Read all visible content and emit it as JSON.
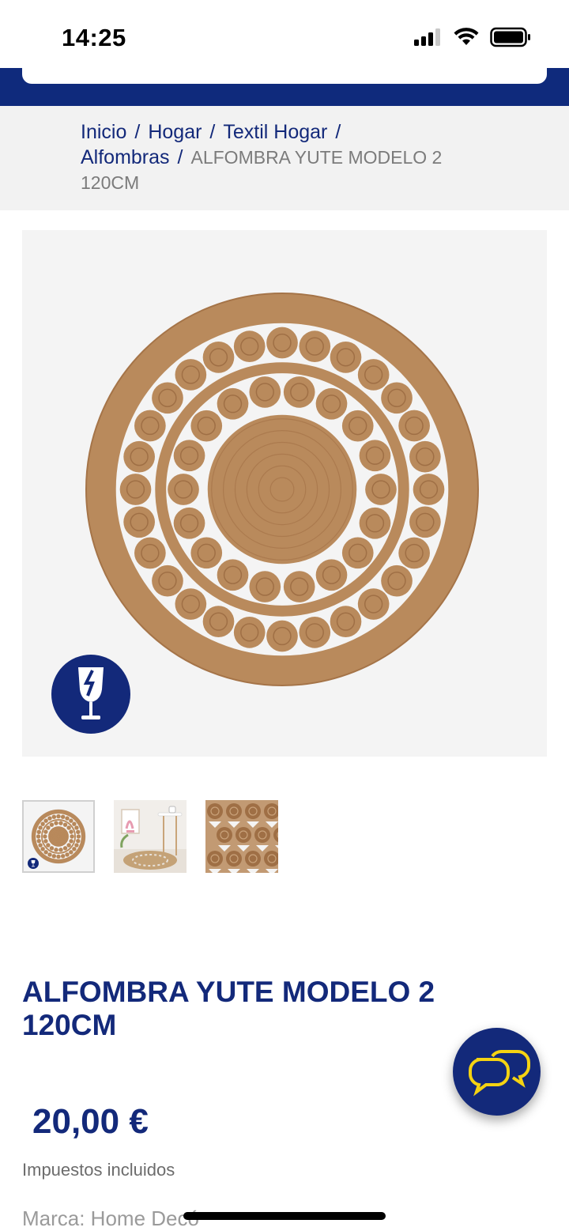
{
  "status_bar": {
    "time": "14:25"
  },
  "breadcrumb": {
    "items": [
      "Inicio",
      "Hogar",
      "Textil Hogar",
      "Alfombras"
    ],
    "separator": "/",
    "current": "ALFOMBRA YUTE MODELO 2 120CM"
  },
  "product": {
    "title": "ALFOMBRA YUTE MODELO 2 120CM",
    "price": "20,00 €",
    "tax_note": "Impuestos incluidos",
    "brand": "Marca: Home Decó"
  },
  "icons": {
    "fragile": "fragile-glass-icon",
    "chat": "chat-bubbles-icon",
    "signal": "cellular-signal-icon",
    "wifi": "wifi-icon",
    "battery": "battery-icon"
  },
  "colors": {
    "brand": "#13297a",
    "accent": "#f5d312",
    "rug": "#b98a5c"
  }
}
